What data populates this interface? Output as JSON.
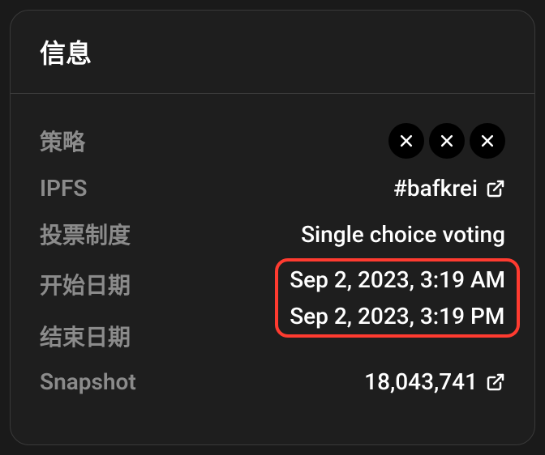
{
  "header": {
    "title": "信息"
  },
  "rows": {
    "strategy": {
      "label": "策略"
    },
    "ipfs": {
      "label": "IPFS",
      "value": "#bafkrei"
    },
    "voting_system": {
      "label": "投票制度",
      "value": "Single choice voting"
    },
    "start_date": {
      "label": "开始日期",
      "value": "Sep 2, 2023, 3:19 AM"
    },
    "end_date": {
      "label": "结束日期",
      "value": "Sep 2, 2023, 3:19 PM"
    },
    "snapshot": {
      "label": "Snapshot",
      "value": "18,043,741"
    }
  }
}
